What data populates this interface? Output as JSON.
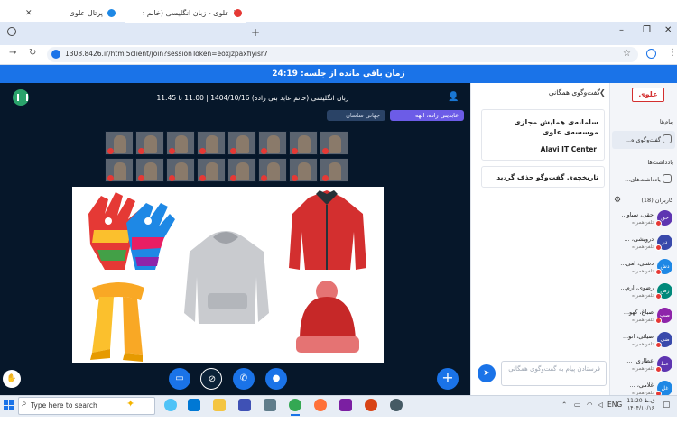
{
  "browser": {
    "tabs": [
      {
        "label": "پرتال علوی",
        "active": false
      },
      {
        "label": "علوی - زبان انگلیسی (خانم عا...",
        "active": true
      }
    ],
    "url": "1308.8426.ir/html5client/join?sessionToken=eoxjzpaxfiyisr7"
  },
  "timer": {
    "text": "زمان باقی مانده از جلسه: 24:19"
  },
  "meeting": {
    "title": "زبان انگلیسی (خانم عابد بنی زاده) 1404/10/16 | 11:00 تا 11:45",
    "talkers": [
      {
        "label": "عابدینی زاده، الهه",
        "primary": true
      },
      {
        "label": "جهانی ساسان",
        "primary": false
      }
    ],
    "webcam_count": 16
  },
  "chat": {
    "header": "گفت‌وگوی همگانی",
    "welcome_line1": "سامانه‌ی همایش مجازی",
    "welcome_line2": "موسسه‌ی علوی",
    "welcome_line3": "Alavi IT Center",
    "cleared": "تاریخچه‌ی گفت‌وگو حذف گردید",
    "input_placeholder": "فرستادن پیام به گفت‌وگوی همگانی"
  },
  "sidebar": {
    "logo": "علوی",
    "messages_title": "پیام‌ها",
    "public_chat": "گفت‌وگوی ه...",
    "notes_title": "یادداشت‌ها",
    "shared_notes": "یادداشت‌های...",
    "users_title": "کاربران (18)",
    "users": [
      {
        "initials": "حق",
        "name": "حقی، سیاو...",
        "role": "تلفن‌همراه",
        "color": "#5e35b1"
      },
      {
        "initials": "در",
        "name": "درویشی، ...",
        "role": "تلفن‌همراه",
        "color": "#3949ab"
      },
      {
        "initials": "دش",
        "name": "دشتی، امی...",
        "role": "تلفن‌همراه",
        "color": "#1e88e5"
      },
      {
        "initials": "رض",
        "name": "رضوی، ارم...",
        "role": "تلفن‌همراه",
        "color": "#00897b"
      },
      {
        "initials": "صب",
        "name": "صباغ، کهو...",
        "role": "تلفن‌همراه",
        "color": "#8e24aa"
      },
      {
        "initials": "ضی",
        "name": "ضیائی، انو...",
        "role": "تلفن‌همراه",
        "color": "#3949ab"
      },
      {
        "initials": "عط",
        "name": "عطاری، ...",
        "role": "تلفن‌همراه",
        "color": "#5e35b1"
      },
      {
        "initials": "غل",
        "name": "غلامی، ...",
        "role": "تلفن‌همراه",
        "color": "#1e88e5"
      }
    ]
  },
  "taskbar": {
    "search_placeholder": "Type here to search",
    "language": "ENG",
    "time": "11:20 ق.ظ",
    "date": "۱۴۰۴/۱۰/۱۶"
  },
  "colors": {
    "accent": "#1a73e8",
    "presentation_bg": "#06172a",
    "presenter_badge": "#6c5ce7",
    "muted": "#e53935"
  }
}
